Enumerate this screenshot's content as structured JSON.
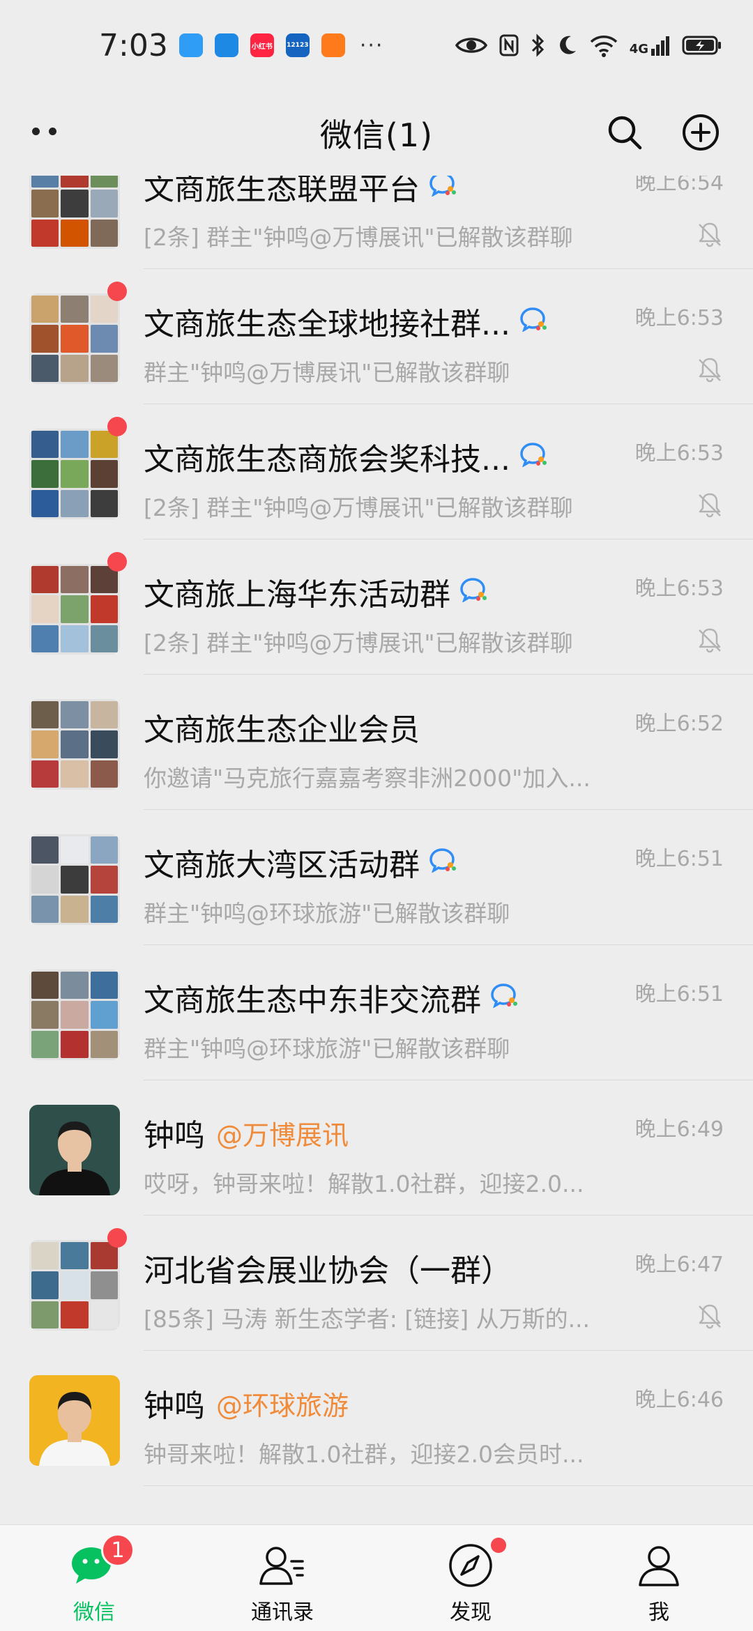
{
  "status_bar": {
    "time": "7:03",
    "network_label": "4G",
    "apps": [
      {
        "name": "chat-app-icon",
        "color": "#2f9cf5",
        "text": ""
      },
      {
        "name": "shield-app-icon",
        "color": "#1e88e5",
        "text": ""
      },
      {
        "name": "xiaohongshu-app-icon",
        "color": "#ff2442",
        "text": "小红书"
      },
      {
        "name": "traffic-12123-app-icon",
        "color": "#1565c0",
        "text": "12123"
      },
      {
        "name": "orange-app-icon",
        "color": "#ff7a1a",
        "text": ""
      }
    ],
    "more": "···"
  },
  "header": {
    "title": "微信(1)"
  },
  "chats": [
    {
      "name": "文商旅生态联盟平台",
      "corp": "",
      "wecom": true,
      "time": "晚上6:54",
      "preview": "[2条] 群主\"钟鸣@万博展讯\"已解散该群聊",
      "muted": true,
      "unread_dot": true,
      "avatar_type": "grid",
      "tiles": [
        "#5a7fa6",
        "#b03a2e",
        "#6b8e5a",
        "#8a6d4f",
        "#3d3d3d",
        "#9aa9b8",
        "#c0392b",
        "#d35400",
        "#7f6a5a"
      ]
    },
    {
      "name": "文商旅生态全球地接社群...",
      "corp": "",
      "wecom": true,
      "time": "晚上6:53",
      "preview": "群主\"钟鸣@万博展讯\"已解散该群聊",
      "muted": true,
      "unread_dot": true,
      "avatar_type": "grid",
      "tiles": [
        "#c9a36b",
        "#8e7f73",
        "#e3d6c8",
        "#a0522d",
        "#e0592a",
        "#6d8bb0",
        "#4a5a6b",
        "#b7a28a",
        "#9b8b7d"
      ]
    },
    {
      "name": "文商旅生态商旅会奖科技...",
      "corp": "",
      "wecom": true,
      "time": "晚上6:53",
      "preview": "[2条] 群主\"钟鸣@万博展讯\"已解散该群聊",
      "muted": true,
      "unread_dot": true,
      "avatar_type": "grid",
      "tiles": [
        "#355e8f",
        "#6b9bc7",
        "#c9a227",
        "#3b6e3b",
        "#7aa85a",
        "#5c4033",
        "#2c5d9a",
        "#8aa0b6",
        "#3d3d3d"
      ]
    },
    {
      "name": "文商旅上海华东活动群",
      "corp": "",
      "wecom": true,
      "time": "晚上6:53",
      "preview": "[2条] 群主\"钟鸣@万博展讯\"已解散该群聊",
      "muted": true,
      "unread_dot": true,
      "avatar_type": "grid",
      "tiles": [
        "#b03a2e",
        "#8d6e63",
        "#5d4037",
        "#e5d3c3",
        "#7ca36b",
        "#c0392b",
        "#4e7fae",
        "#a3c1da",
        "#6b8e9e"
      ]
    },
    {
      "name": "文商旅生态企业会员",
      "corp": "",
      "wecom": false,
      "time": "晚上6:52",
      "preview": "你邀请\"马克旅行嘉嘉考察非洲2000\"加入...",
      "muted": false,
      "unread_dot": false,
      "avatar_type": "grid",
      "tiles": [
        "#6d5d4b",
        "#7c8fa3",
        "#c8b59f",
        "#d7a86e",
        "#5b6f86",
        "#3a4b5c",
        "#b83b3b",
        "#d9bfa5",
        "#8c5a4a"
      ]
    },
    {
      "name": "文商旅大湾区活动群",
      "corp": "",
      "wecom": true,
      "time": "晚上6:51",
      "preview": "群主\"钟鸣@环球旅游\"已解散该群聊",
      "muted": false,
      "unread_dot": false,
      "avatar_type": "grid",
      "tiles": [
        "#4b5563",
        "#e8eaed",
        "#8aa6c1",
        "#d5d5d5",
        "#3c3c3c",
        "#b5453c",
        "#7a93ad",
        "#c9b28f",
        "#4d7ea8"
      ]
    },
    {
      "name": "文商旅生态中东非交流群",
      "corp": "",
      "wecom": true,
      "time": "晚上6:51",
      "preview": "群主\"钟鸣@环球旅游\"已解散该群聊",
      "muted": false,
      "unread_dot": false,
      "avatar_type": "grid",
      "tiles": [
        "#5d4a3a",
        "#7b8c9c",
        "#3e6e9c",
        "#8a7a64",
        "#c9a9a0",
        "#5fa0d1",
        "#7ba37a",
        "#b3312f",
        "#a39078"
      ]
    },
    {
      "name": "钟鸣",
      "corp": "@万博展讯",
      "wecom": false,
      "time": "晚上6:49",
      "preview": "哎呀，钟哥来啦！解散1.0社群，迎接2.0...",
      "muted": false,
      "unread_dot": false,
      "avatar_type": "person",
      "bg": "#2f4f4a",
      "shirt": "#111111",
      "face": "#e8c3a3"
    },
    {
      "name": "河北省会展业协会（一群）",
      "corp": "",
      "wecom": false,
      "time": "晚上6:47",
      "preview": "[85条] 马涛 新生态学者: [链接] 从万斯的...",
      "muted": true,
      "unread_dot": true,
      "avatar_type": "grid",
      "tiles": [
        "#d9d4c6",
        "#4a7a9a",
        "#a83a32",
        "#3d6b8e",
        "#d8e0e8",
        "#8f8f8f",
        "#7d9a6d",
        "#c0392b",
        "#e6e6e6"
      ]
    },
    {
      "name": "钟鸣",
      "corp": "@环球旅游",
      "wecom": false,
      "time": "晚上6:46",
      "preview": "钟哥来啦！解散1.0社群，迎接2.0会员时...",
      "muted": false,
      "unread_dot": false,
      "avatar_type": "person",
      "bg": "#f3b422",
      "shirt": "#f6f6f6",
      "face": "#e9c09d"
    }
  ],
  "tabs": [
    {
      "label": "微信",
      "name": "tab-chats",
      "active": true,
      "badge": "1",
      "dot": false
    },
    {
      "label": "通讯录",
      "name": "tab-contacts",
      "active": false,
      "badge": "",
      "dot": false
    },
    {
      "label": "发现",
      "name": "tab-discover",
      "active": false,
      "badge": "",
      "dot": true
    },
    {
      "label": "我",
      "name": "tab-me",
      "active": false,
      "badge": "",
      "dot": false
    }
  ],
  "colors": {
    "accent_green": "#07c160",
    "unread_red": "#f5474d",
    "corp_orange": "#ef8b3a",
    "secondary_text": "#a8a8a8",
    "background": "#ededed"
  }
}
